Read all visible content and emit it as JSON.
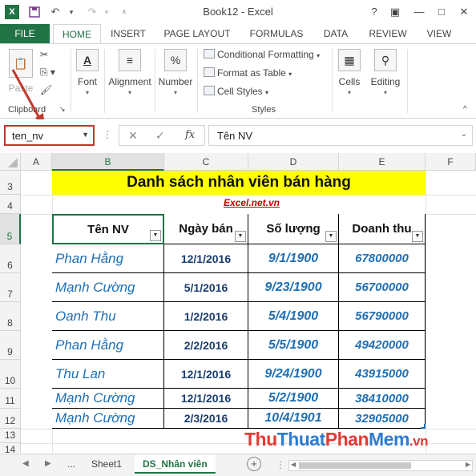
{
  "window": {
    "title": "Book12 - Excel",
    "help_label": "?",
    "min_label": "—",
    "max_label": "□",
    "close_label": "✕"
  },
  "qat": {
    "app_icon": "excel-app-icon",
    "save_icon": "save-icon",
    "undo_icon": "undo-icon",
    "redo_icon": "redo-icon",
    "customize_icon": "customize-icon"
  },
  "tabs": [
    "FILE",
    "HOME",
    "INSERT",
    "PAGE LAYOUT",
    "FORMULAS",
    "DATA",
    "REVIEW",
    "VIEW"
  ],
  "ribbon": {
    "paste": "Paste",
    "clipboard": "Clipboard",
    "font": "Font",
    "alignment": "Alignment",
    "number": "Number",
    "conditional": "Conditional Formatting",
    "format_table": "Format as Table",
    "cell_styles": "Cell Styles",
    "styles": "Styles",
    "cells": "Cells",
    "editing": "Editing"
  },
  "formula_bar": {
    "name_box": "ten_nv",
    "cancel": "✕",
    "enter": "✓",
    "fx": "fx",
    "formula": "Tên NV"
  },
  "columns": [
    "A",
    "B",
    "C",
    "D",
    "E",
    "F"
  ],
  "rows": [
    "3",
    "4",
    "5",
    "6",
    "7",
    "8",
    "9",
    "10",
    "11",
    "12",
    "13",
    "14"
  ],
  "sheet": {
    "title": "Danh sách nhân viên bán hàng",
    "subtitle": "Excel.net.vn",
    "headers": [
      "Tên NV",
      "Ngày bán",
      "Số lượng",
      "Doanh thu"
    ],
    "data": [
      [
        "Phan Hằng",
        "12/1/2016",
        "9/1/1900",
        "67800000"
      ],
      [
        "Mạnh Cường",
        "5/1/2016",
        "9/23/1900",
        "56700000"
      ],
      [
        "Oanh Thu",
        "1/2/2016",
        "5/4/1900",
        "56790000"
      ],
      [
        "Phan Hằng",
        "2/2/2016",
        "5/5/1900",
        "49420000"
      ],
      [
        "Thu Lan",
        "12/1/2016",
        "9/24/1900",
        "43915000"
      ],
      [
        "Mạnh Cường",
        "12/1/2016",
        "5/2/1900",
        "38410000"
      ],
      [
        "Mạnh Cường",
        "2/3/2016",
        "10/4/1901",
        "32905000"
      ]
    ]
  },
  "sheet_tabs": {
    "ellipsis": "...",
    "sheet1": "Sheet1",
    "active": "DS_Nhân viên",
    "add": "+"
  },
  "watermark": {
    "part1": "Thu",
    "part2": "Thuat",
    "part3": "Phan",
    "part4": "Mem",
    "part5": ".vn"
  }
}
